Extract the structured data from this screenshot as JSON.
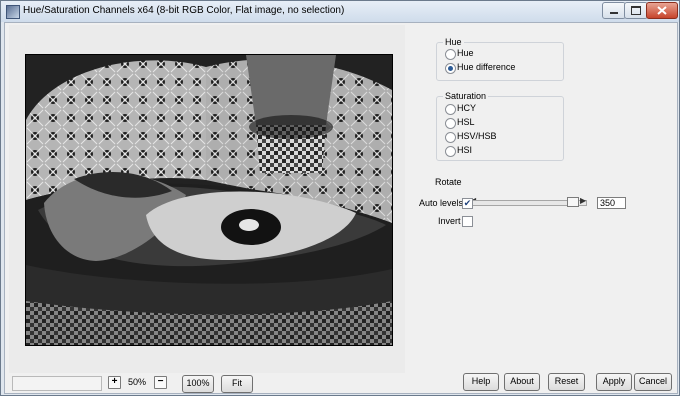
{
  "window": {
    "title": "Hue/Saturation Channels x64 (8-bit RGB Color, Flat image, no selection)",
    "controls": [
      "minimize-button",
      "maximize-button",
      "close-button"
    ]
  },
  "zoom": {
    "minus_glyph": "−",
    "plus_glyph": "+",
    "value": "50%",
    "hundred_label": "100%",
    "fit_label": "Fit"
  },
  "hue_group": {
    "title": "Hue",
    "options": [
      {
        "label": "Hue",
        "selected": false
      },
      {
        "label": "Hue difference",
        "selected": true
      }
    ]
  },
  "saturation_group": {
    "title": "Saturation",
    "options": [
      {
        "label": "HCY",
        "selected": false
      },
      {
        "label": "HSL",
        "selected": false
      },
      {
        "label": "HSV/HSB",
        "selected": false
      },
      {
        "label": "HSI",
        "selected": false
      }
    ]
  },
  "rotate": {
    "label": "Rotate",
    "value": "350",
    "slider_fraction": 0.97
  },
  "options": {
    "auto_levels_label": "Auto levels",
    "auto_levels_checked": true,
    "invert_label": "Invert",
    "invert_checked": false
  },
  "buttons": {
    "help": "Help",
    "about": "About",
    "reset": "Reset",
    "apply": "Apply",
    "cancel": "Cancel"
  }
}
